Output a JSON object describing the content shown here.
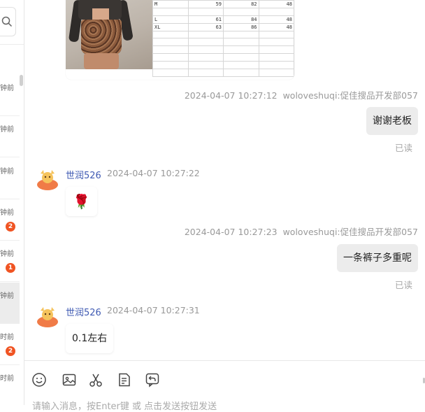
{
  "sidebar": {
    "items": [
      {
        "time": "钟前",
        "badge": null,
        "selected": false
      },
      {
        "time": "钟前",
        "badge": null,
        "selected": false
      },
      {
        "time": "钟前",
        "badge": null,
        "selected": false
      },
      {
        "time": "钟前",
        "badge": "2",
        "selected": false
      },
      {
        "time": "钟前",
        "badge": "1",
        "selected": false
      },
      {
        "time": "钟前",
        "badge": null,
        "selected": true
      },
      {
        "time": "时前",
        "badge": "2",
        "selected": false
      },
      {
        "time": "时前",
        "badge": null,
        "selected": false
      }
    ]
  },
  "size_table": {
    "rows": [
      [
        "M",
        "59",
        "82",
        "48"
      ],
      [
        "",
        "",
        "",
        ""
      ],
      [
        "L",
        "61",
        "84",
        "48"
      ],
      [
        "XL",
        "63",
        "86",
        "48"
      ],
      [
        "",
        "",
        "",
        ""
      ],
      [
        "",
        "",
        "",
        ""
      ],
      [
        "",
        "",
        "",
        ""
      ],
      [
        "",
        "",
        "",
        ""
      ],
      [
        "",
        "",
        "",
        ""
      ],
      [
        "",
        "",
        "",
        ""
      ]
    ]
  },
  "messages": {
    "m1": {
      "time": "2024-04-07 10:27:12",
      "sender": "woloveshuqi:促佳搜品开发部057",
      "text": "谢谢老板",
      "status": "已读"
    },
    "m2": {
      "sender": "世润526",
      "time": "2024-04-07 10:27:22",
      "emoji": "🌹"
    },
    "m3": {
      "time": "2024-04-07 10:27:23",
      "sender": "woloveshuqi:促佳搜品开发部057",
      "text": "一条裤子多重呢",
      "status": "已读"
    },
    "m4": {
      "sender": "世润526",
      "time": "2024-04-07 10:27:31",
      "text": "0.1左右"
    }
  },
  "input": {
    "placeholder": "请输入消息，按Enter键 或 点击发送按钮发送"
  },
  "colors": {
    "badge": "#f05423",
    "sender_name": "#3f5ab3",
    "outgoing_bubble": "#ececec"
  }
}
